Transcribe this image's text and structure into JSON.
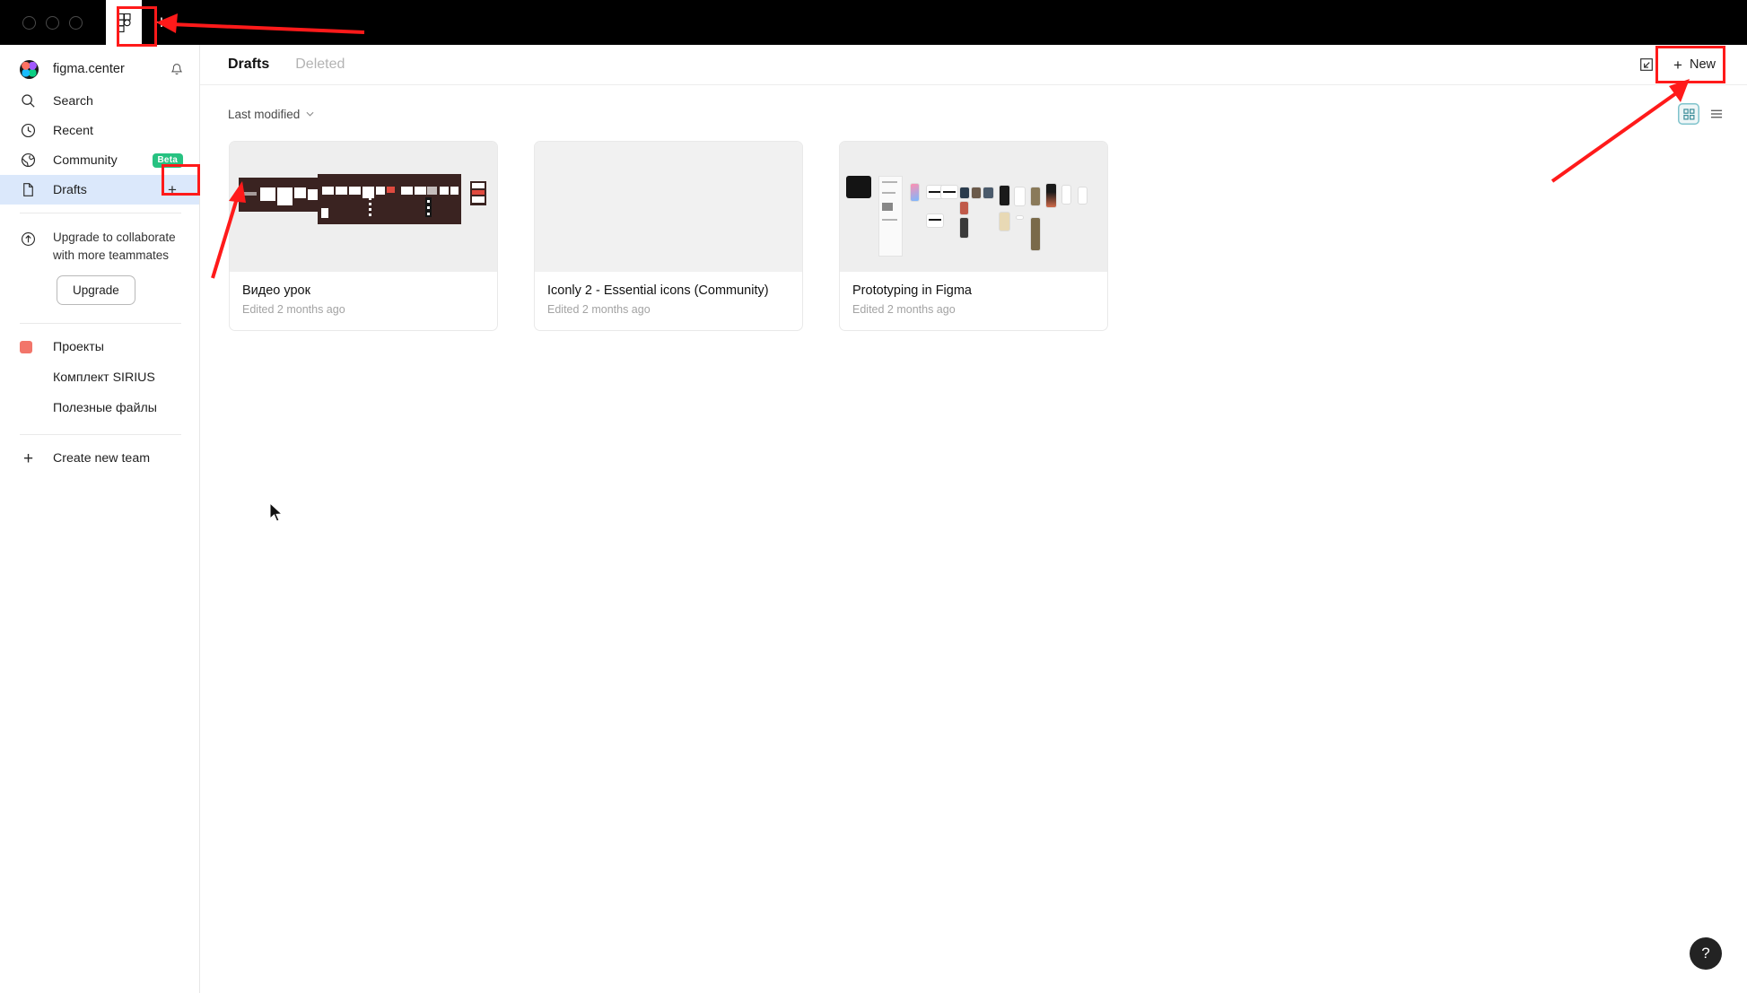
{
  "window": {
    "traffic_lights": [
      "close",
      "minimize",
      "zoom"
    ],
    "logo_icon": "figma-logo-icon",
    "new_tab_label": "+"
  },
  "sidebar": {
    "account": {
      "name": "figma.center",
      "avatar_icon": "figma-avatar",
      "notifications_icon": "bell-icon"
    },
    "nav": [
      {
        "label": "Search",
        "icon": "search-icon"
      },
      {
        "label": "Recent",
        "icon": "clock-icon"
      },
      {
        "label": "Community",
        "icon": "globe-icon",
        "badge": "Beta"
      },
      {
        "label": "Drafts",
        "icon": "file-icon",
        "selected": true,
        "action": "+"
      }
    ],
    "upgrade": {
      "icon": "arrow-up-circle-icon",
      "text": "Upgrade to collaborate\nwith more teammates",
      "button_label": "Upgrade"
    },
    "projects": [
      {
        "label": "Проекты",
        "swatch": "#f2756a",
        "is_team": true
      },
      {
        "label": "Комплект SIRIUS",
        "is_team": false
      },
      {
        "label": "Полезные файлы",
        "is_team": false
      }
    ],
    "create_team": {
      "label": "Create new team",
      "icon": "plus-icon"
    }
  },
  "main": {
    "tabs": [
      {
        "label": "Drafts",
        "active": true
      },
      {
        "label": "Deleted",
        "active": false
      }
    ],
    "import_icon": "import-file-icon",
    "new_button": {
      "label": "New",
      "icon": "plus-icon"
    },
    "sort": {
      "label": "Last modified",
      "icon": "chevron-down-icon"
    },
    "view_toggle": [
      {
        "name": "grid-view",
        "icon": "grid-icon",
        "active": true
      },
      {
        "name": "list-view",
        "icon": "list-icon",
        "active": false
      }
    ],
    "files": [
      {
        "title": "Видео урок",
        "subtitle": "Edited 2 months ago",
        "thumb": "dark-boards"
      },
      {
        "title": "Iconly 2 - Essential icons (Community)",
        "subtitle": "Edited 2 months ago",
        "thumb": "blank"
      },
      {
        "title": "Prototyping in Figma",
        "subtitle": "Edited 2 months ago",
        "thumb": "mobile-screens"
      }
    ]
  },
  "help": {
    "label": "?"
  },
  "annotations": {
    "accent_color": "#ff1a1a",
    "boxes": [
      "new-tab-button",
      "drafts-add-button",
      "new-file-button"
    ]
  }
}
